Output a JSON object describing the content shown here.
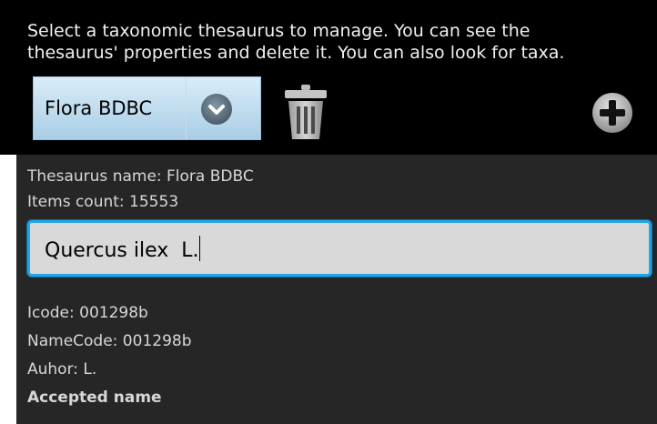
{
  "instructions": "Select a taxonomic thesaurus to manage. You can see the\nthesaurus' properties and delete it. You can also look for taxa.",
  "thesaurus_spinner": {
    "selected": "Flora BDBC"
  },
  "icons": {
    "dropdown": "chevron-down-icon",
    "delete": "trash-icon",
    "add": "plus-circle-icon"
  },
  "details": {
    "thesaurus_name": "Thesaurus name: Flora BDBC",
    "items_count": "Items count: 15553"
  },
  "search": {
    "value": "Quercus ilex  L."
  },
  "taxon": {
    "icode": "Icode: 001298b",
    "namecode": "NameCode: 001298b",
    "author": "Auhor: L.",
    "status": "Accepted name"
  },
  "colors": {
    "top_background": "#000000",
    "details_background": "#262626",
    "focus_border": "#21a5e6",
    "spinner_background": "#b8d7ec"
  }
}
